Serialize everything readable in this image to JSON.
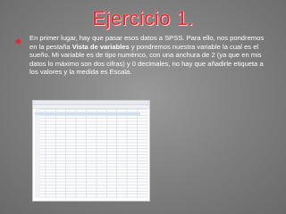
{
  "slide": {
    "title": "Ejercicio 1.",
    "body": {
      "part1": "En primer lugar, hay que pasar esos datos a SPSS. Para ello, nos pondremos en la pestaña ",
      "bold": "Vista de variables",
      "part2": " y pondremos nuestra variable la cual es el sueño. Mi variable es de tipo numérico, con una anchura de 2 (ya que en mis datos lo máximo son dos cifras) y 0 decimales, no hay que añadirle etiqueta a los valores y la medida es Escala."
    },
    "accent_color": "#e8262e"
  }
}
